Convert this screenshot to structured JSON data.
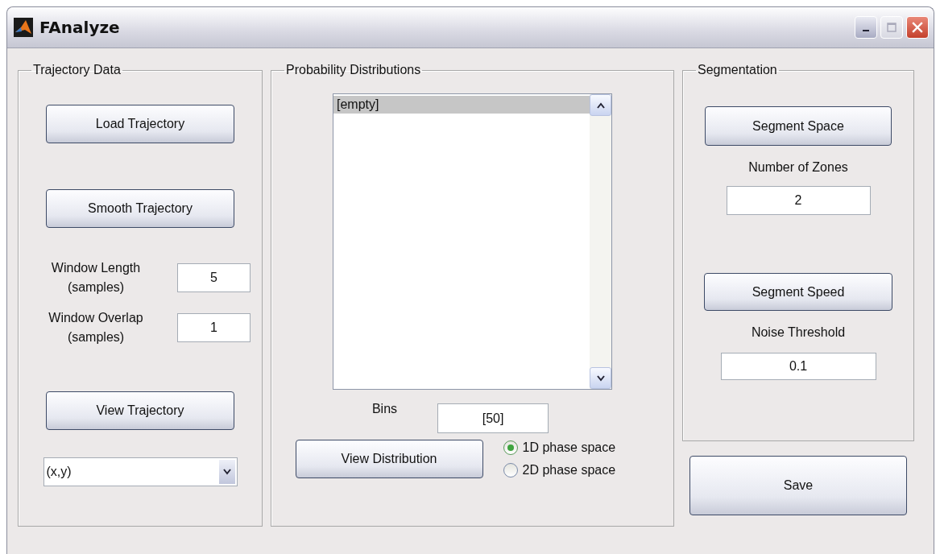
{
  "window": {
    "title": "FAnalyze"
  },
  "trajectory_data": {
    "title": "Trajectory Data",
    "load_button": "Load Trajectory",
    "smooth_button": "Smooth Trajectory",
    "params": [
      {
        "label": "Window Length",
        "sub": "(samples)",
        "value": "5"
      },
      {
        "label": "Window Overlap",
        "sub": "(samples)",
        "value": "1"
      }
    ],
    "view_button": "View Trajectory",
    "dropdown": {
      "value": "(x,y)"
    }
  },
  "probability_distributions": {
    "title": "Probability Distributions",
    "list_items": [
      {
        "label": "[empty]",
        "selected": true
      }
    ],
    "bins": {
      "label": "Bins",
      "value": "[50]"
    },
    "view_button": "View Distribution",
    "radios": [
      {
        "label": "1D phase space",
        "selected": true
      },
      {
        "label": "2D phase space",
        "selected": false
      }
    ]
  },
  "segmentation": {
    "title": "Segmentation",
    "space_button": "Segment Space",
    "zones": {
      "label": "Number of Zones",
      "value": "2"
    },
    "speed_button": "Segment Speed",
    "noise": {
      "label": "Noise Threshold",
      "value": "0.1"
    }
  },
  "save_button": "Save"
}
